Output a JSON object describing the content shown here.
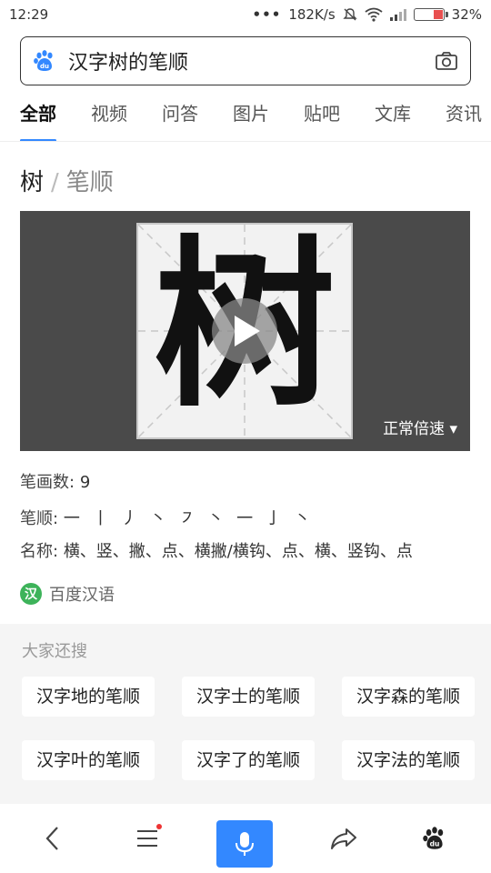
{
  "status": {
    "time": "12:29",
    "dots": "•••",
    "speed": "182K/s",
    "battery": "32%",
    "battery_fraction": 0.32
  },
  "search": {
    "query": "汉字树的笔顺"
  },
  "tabs": [
    {
      "label": "全部"
    },
    {
      "label": "视频"
    },
    {
      "label": "问答"
    },
    {
      "label": "图片"
    },
    {
      "label": "贴吧"
    },
    {
      "label": "文库"
    },
    {
      "label": "资讯"
    }
  ],
  "result": {
    "char": "树",
    "separator": "/",
    "subtitle": "笔顺",
    "video_speed": "正常倍速 ▾",
    "stroke_count_label": "笔画数:",
    "stroke_count_value": "9",
    "stroke_order_label": "笔顺:",
    "stroke_order_value": "一 丨 丿 丶 ㇇ 丶 一 亅 丶",
    "names_label": "名称:",
    "names_value": "横、竖、撇、点、横撇/横钩、点、横、竖钩、点",
    "source_badge": "汉",
    "source": "百度汉语"
  },
  "related": {
    "heading": "大家还搜",
    "items": [
      {
        "label": "汉字地的笔顺"
      },
      {
        "label": "汉字士的笔顺"
      },
      {
        "label": "汉字森的笔顺"
      },
      {
        "label": "汉字叶的笔顺"
      },
      {
        "label": "汉字了的笔顺"
      },
      {
        "label": "汉字法的笔顺"
      }
    ]
  },
  "colors": {
    "accent": "#3388ff",
    "badge_green": "#3db35a",
    "video_bg": "#4a4a4a"
  },
  "icons": [
    "baidu-paw-icon",
    "camera-icon",
    "wifi-icon",
    "signal-icon",
    "mute-icon",
    "back-icon",
    "menu-icon",
    "mic-icon",
    "share-icon",
    "baidu-home-icon",
    "play-icon"
  ]
}
